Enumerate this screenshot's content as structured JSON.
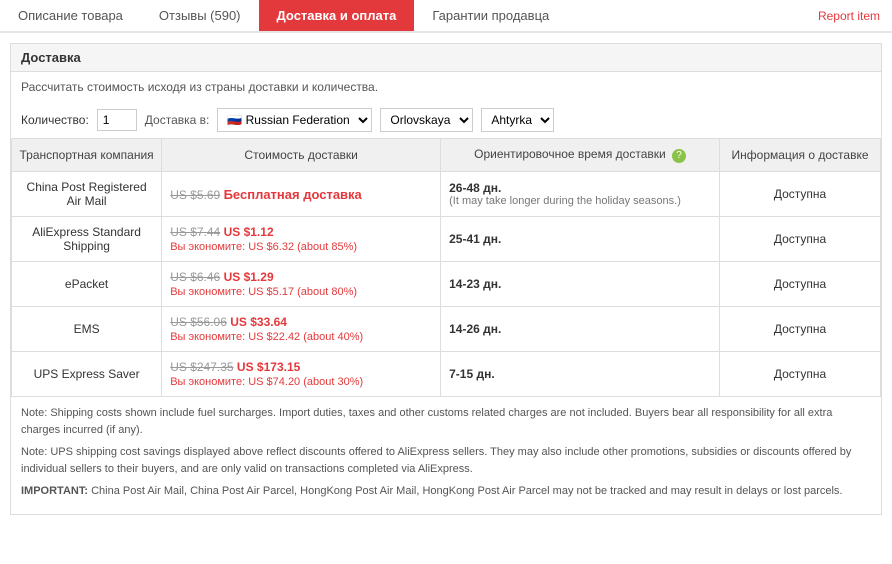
{
  "nav": {
    "tabs": [
      {
        "id": "description",
        "label": "Описание товара",
        "active": false
      },
      {
        "id": "reviews",
        "label": "Отзывы (590)",
        "active": false
      },
      {
        "id": "shipping",
        "label": "Доставка и оплата",
        "active": true
      },
      {
        "id": "guarantee",
        "label": "Гарантии продавца",
        "active": false
      }
    ],
    "report_item": "Report item"
  },
  "section": {
    "title": "Доставка",
    "calc_label": "Рассчитать стоимость исходя из страны доставки и количества.",
    "qty_label": "Количество:",
    "qty_value": "1",
    "ship_to_label": "Доставка в:",
    "country": "Russian Federation",
    "region1": "Orlovskaya",
    "region2": "Ahtyrka"
  },
  "table": {
    "headers": [
      "Транспортная компания",
      "Стоимость доставки",
      "Ориентировочное время доставки",
      "Информация о доставке"
    ],
    "rows": [
      {
        "company": "China Post Registered Air Mail",
        "original_price": "US $5.69",
        "current_price": "",
        "free": "Бесплатная доставка",
        "save": "",
        "time_main": "26-48 дн.",
        "time_note": "(It may take longer during the holiday seasons.)",
        "availability": "Доступна"
      },
      {
        "company": "AliExpress Standard Shipping",
        "original_price": "US $7.44",
        "current_price": "US $1.12",
        "free": "",
        "save": "Вы экономите: US $6.32 (about 85%)",
        "time_main": "25-41 дн.",
        "time_note": "",
        "availability": "Доступна"
      },
      {
        "company": "ePacket",
        "original_price": "US $6.46",
        "current_price": "US $1.29",
        "free": "",
        "save": "Вы экономите: US $5.17 (about 80%)",
        "time_main": "14-23 дн.",
        "time_note": "",
        "availability": "Доступна"
      },
      {
        "company": "EMS",
        "original_price": "US $56.06",
        "current_price": "US $33.64",
        "free": "",
        "save": "Вы экономите: US $22.42 (about 40%)",
        "time_main": "14-26 дн.",
        "time_note": "",
        "availability": "Доступна"
      },
      {
        "company": "UPS Express Saver",
        "original_price": "US $247.35",
        "current_price": "US $173.15",
        "free": "",
        "save": "Вы экономите: US $74.20 (about 30%)",
        "time_main": "7-15 дн.",
        "time_note": "",
        "availability": "Доступна"
      }
    ]
  },
  "notes": {
    "note1": "Note: Shipping costs shown include fuel surcharges. Import duties, taxes and other customs related charges are not included. Buyers bear all responsibility for all extra charges incurred (if any).",
    "note2": "Note: UPS shipping cost savings displayed above reflect discounts offered to AliExpress sellers. They may also include other promotions, subsidies or discounts offered by individual sellers to their buyers, and are only valid on transactions completed via AliExpress.",
    "note3_label": "IMPORTANT:",
    "note3_text": " China Post Air Mail, China Post Air Parcel, HongKong Post Air Mail, HongKong Post Air Parcel may not be tracked and may result in delays or lost parcels."
  }
}
